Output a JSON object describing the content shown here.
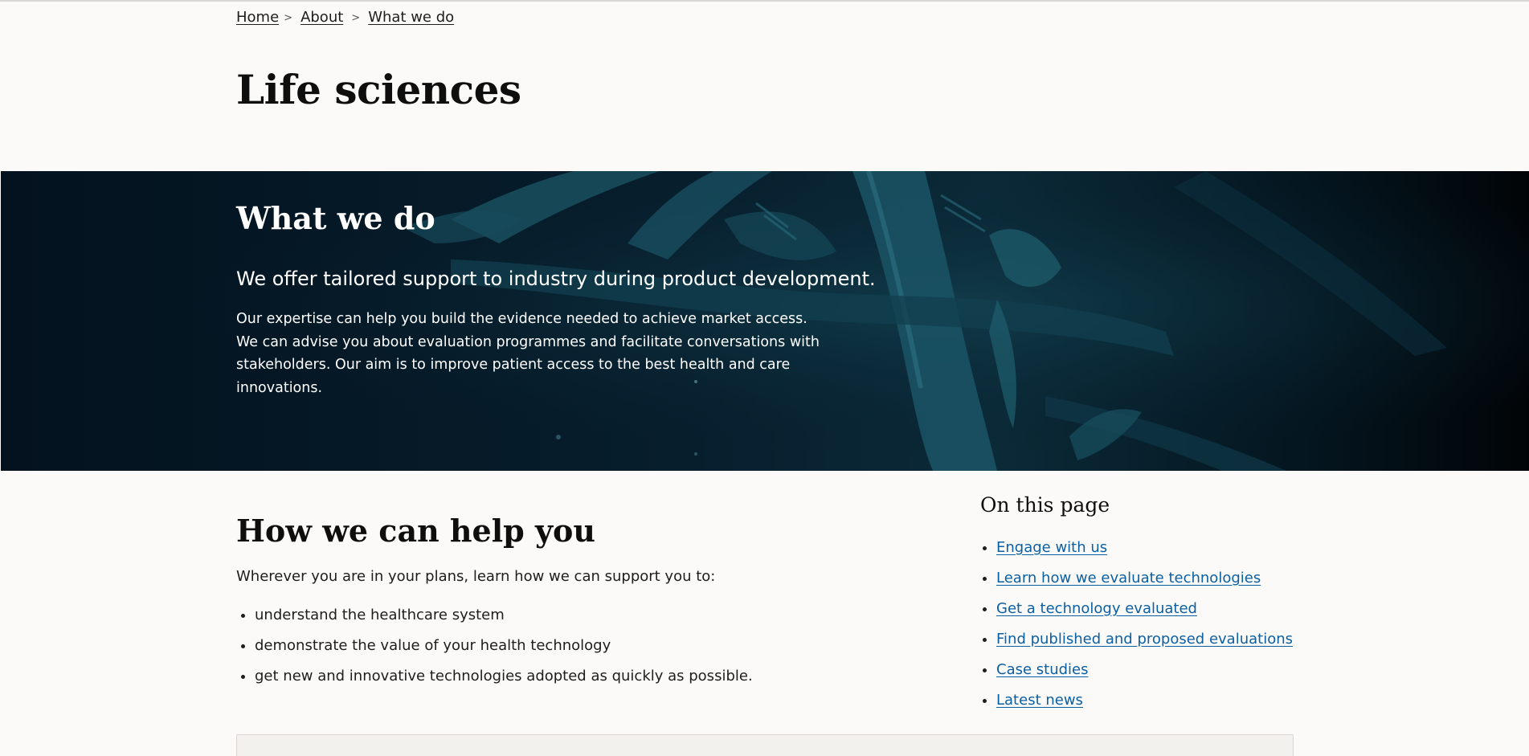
{
  "breadcrumb": {
    "items": [
      {
        "label": "Home"
      },
      {
        "label": "About"
      },
      {
        "label": "What we do"
      }
    ],
    "separator": ">"
  },
  "page_title": "Life sciences",
  "hero": {
    "title": "What we do",
    "lead": "We offer tailored support to industry during product development.",
    "body": "Our expertise can help you build the evidence needed to achieve market access. We can advise you about evaluation programmes and facilitate conversations with stakeholders. Our aim is to improve patient access to the best health and care innovations.",
    "background_image": "dna-helix-image"
  },
  "main": {
    "section_title": "How we can help you",
    "intro": "Wherever you are in your plans, learn how we can support you to:",
    "list": [
      "understand the healthcare system",
      "demonstrate the value of your health technology",
      "get new and innovative technologies adopted as quickly as possible."
    ]
  },
  "on_this_page": {
    "title": "On this page",
    "links": [
      "Engage with us",
      "Learn how we evaluate technologies",
      "Get a technology evaluated",
      "Find published and proposed evaluations",
      "Case studies",
      "Latest news"
    ]
  },
  "colors": {
    "link": "#0b5fa3",
    "page_background": "#fbfaf8",
    "hero_background": "#071e2d",
    "text": "#1d1d1d"
  }
}
